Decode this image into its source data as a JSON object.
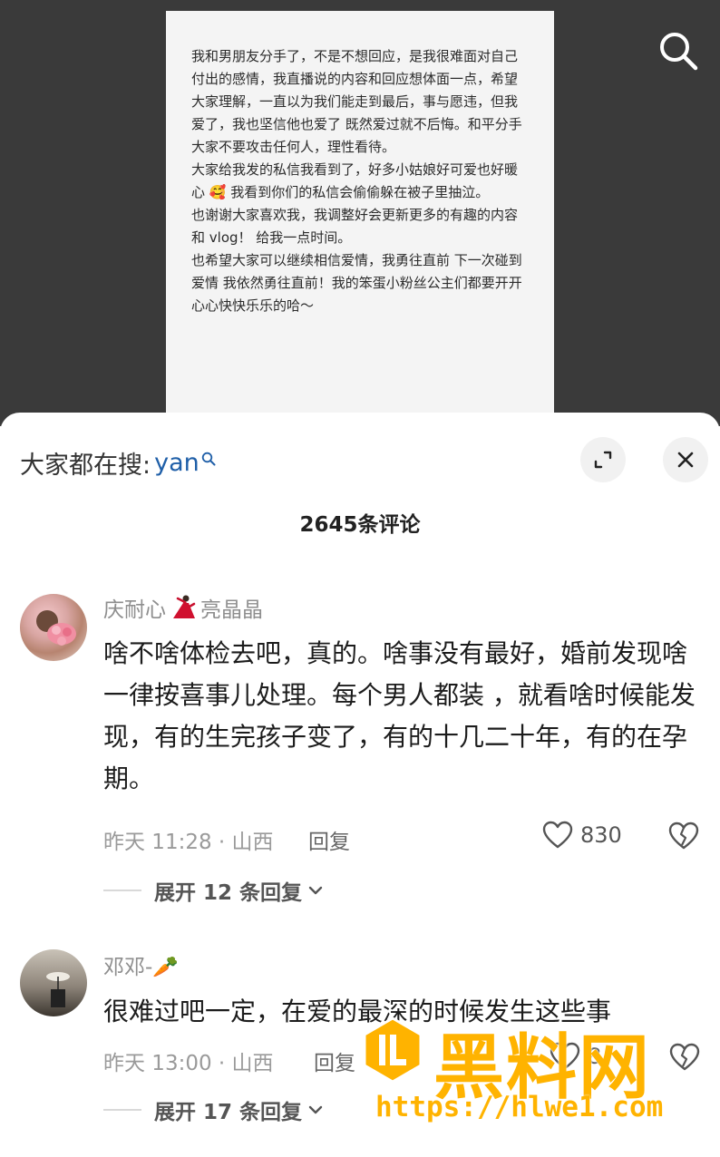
{
  "video": {
    "note_paragraphs": [
      "我和男朋友分手了，不是不想回应，是我很难面对自己付出的感情，我直播说的内容和回应想体面一点，希望大家理解，一直以为我们能走到最后，事与愿违，但我爱了，我也坚信他也爱了 既然爱过就不后悔。和平分手 大家不要攻击任何人，理性看待。",
      "大家给我发的私信我看到了，好多小姑娘好可爱也好暖心 🥰 我看到你们的私信会偷偷躲在被子里抽泣。",
      "也谢谢大家喜欢我，我调整好会更新更多的有趣的内容 和 vlog！ 给我一点时间。",
      "也希望大家可以继续相信爱情，我勇往直前 下一次碰到爱情 我依然勇往直前！我的笨蛋小粉丝公主们都要开开心心快快乐乐的哈～"
    ],
    "search_icon": "search-icon"
  },
  "sheet": {
    "everyone_search_label": "大家都在搜:",
    "everyone_search_query": "yan",
    "comment_count": "2645条评论"
  },
  "comments": [
    {
      "user_a": "庆耐心",
      "user_b": "亮晶晶",
      "text": "啥不啥体检去吧，真的。啥事没有最好，婚前发现啥一律按喜事儿处理。每个男人都装 ，就看啥时候能发现，有的生完孩子变了，有的十几二十年，有的在孕期。",
      "meta": "昨天 11:28 · 山西",
      "reply": "回复",
      "likes": "830",
      "expand": "展开 12 条回复"
    },
    {
      "user_a": "邓邓-🥕",
      "text": "很难过吧一定，在爱的最深的时候发生这些事",
      "meta": "昨天 13:00 · 山西",
      "reply": "回复",
      "likes": "8",
      "expand": "展开 17 条回复"
    }
  ],
  "watermark": {
    "title": "黑料网",
    "url": "https://hlwe1.com"
  }
}
